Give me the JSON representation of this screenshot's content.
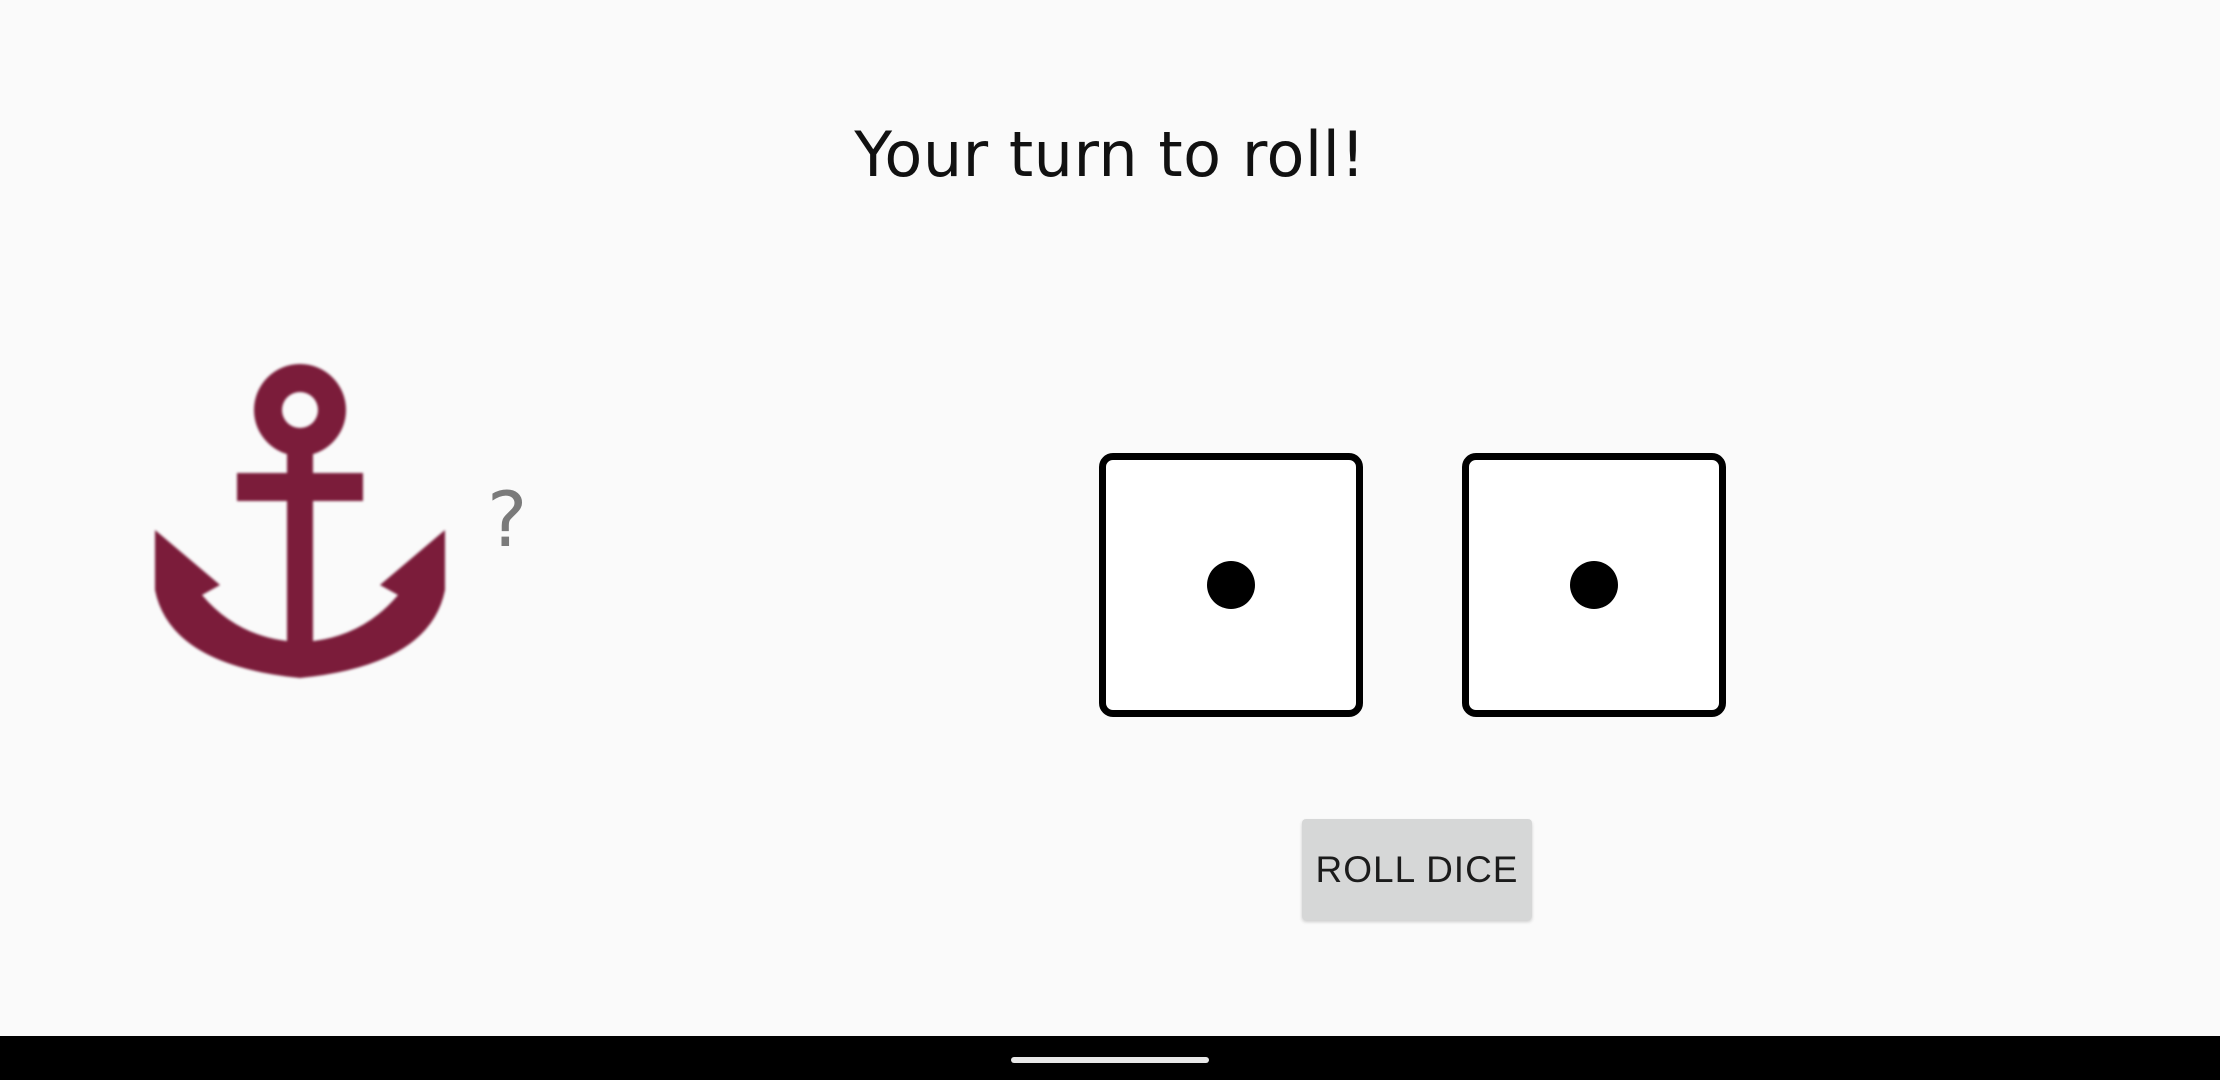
{
  "game": {
    "status_text": "Your turn to roll!",
    "player_icon": "anchor-icon",
    "player_icon_color": "#7b1c3a",
    "guess_text": "?",
    "dice": [
      {
        "value": 1
      },
      {
        "value": 1
      }
    ],
    "roll_button_label": "ROLL DICE"
  },
  "system": {
    "nav_handle": "home-handle"
  }
}
